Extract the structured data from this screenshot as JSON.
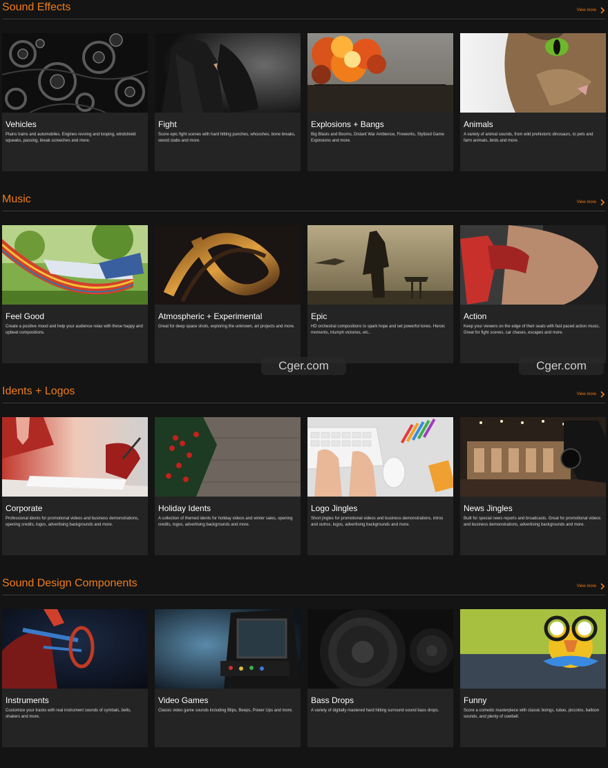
{
  "colors": {
    "accent": "#f07d1a",
    "background": "#141414",
    "card": "#242424"
  },
  "sections": [
    {
      "title": "Sound Effects",
      "view_more": "View more",
      "cards": [
        {
          "title": "Vehicles",
          "description": "Plains trains and automobiles. Engines revving and looping, windshield squeaks, passing, break screeches and more."
        },
        {
          "title": "Fight",
          "description": "Score epic fight scenes with hard hitting punches, whooshes, bone breaks, sword stabs and more."
        },
        {
          "title": "Explosions + Bangs",
          "description": "Big Blasts and Booms, Distant War Ambience, Fireworks, Stylized Game Explosions and more."
        },
        {
          "title": "Animals",
          "description": "A variety of animal sounds, from wild prehistoric dinosaurs, to pets and farm animals, birds and more."
        }
      ]
    },
    {
      "title": "Music",
      "view_more": "View more",
      "cards": [
        {
          "title": "Feel Good",
          "description": "Create a positive mood and help your audience relax with these happy and upbeat compositions."
        },
        {
          "title": "Atmospheric + Experimental",
          "description": "Great for deep space shots, exploring the unknown, art projects and more."
        },
        {
          "title": "Epic",
          "description": "HD orchestral compositions to spark hope and set powerful tones. Heroic moments, triumph victories, etc.."
        },
        {
          "title": "Action",
          "description": "Keep your viewers on the edge of their seats with fast paced action music. Great for fight scenes, car chases, escapes and more."
        }
      ]
    },
    {
      "title": "Idents + Logos",
      "view_more": "View more",
      "cards": [
        {
          "title": "Corporate",
          "description": "Professional idents for promotional videos and business demonstrations, opening credits, logos, advertising backgrounds and more."
        },
        {
          "title": "Holiday Idents",
          "description": "A collection of themed idents for holiday videos and winter sales, opening credits, logos, advertising backgrounds and more."
        },
        {
          "title": "Logo Jingles",
          "description": "Short jingles for promotional videos and business demonstrations, intros and outros, logos, advertising backgrounds and more."
        },
        {
          "title": "News Jingles",
          "description": "Built for special news reports and broadcasts. Great for promotional videos and business demonstrations, advertising backgrounds and more."
        }
      ]
    },
    {
      "title": "Sound Design Components",
      "view_more": "View more",
      "cards": [
        {
          "title": "Instruments",
          "description": "Customize your tracks with real instrument sounds of cymbals, bells, shakers and more."
        },
        {
          "title": "Video Games",
          "description": "Classic video game sounds including Blips, Beeps, Power Ups and more."
        },
        {
          "title": "Bass Drops",
          "description": "A variety of digitally mastered hard hitting surround sound bass drops."
        },
        {
          "title": "Funny",
          "description": "Score a comedic masterpiece with classic boings, tubas, piccolos, balloon sounds, and plenty of cowbell."
        }
      ]
    }
  ],
  "watermark": {
    "text": "Cger.com"
  }
}
